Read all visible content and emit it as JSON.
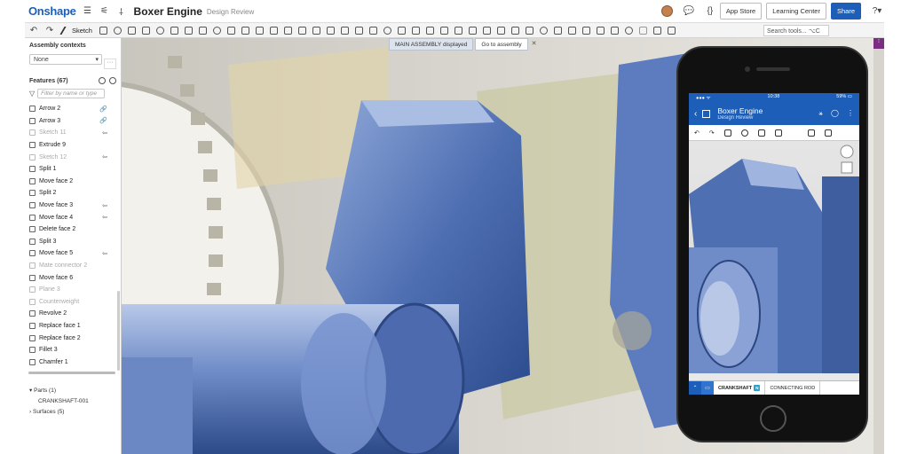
{
  "app": {
    "logo": "Onshape",
    "doc_title": "Boxer Engine",
    "doc_subtitle": "Design Review",
    "buttons": {
      "app_store": "App Store",
      "learning_center": "Learning Center",
      "share": "Share"
    }
  },
  "toolbar": {
    "sketch_label": "Sketch",
    "search_placeholder": "Search tools... ⌥C"
  },
  "banner": {
    "message": "MAIN ASSEMBLY displayed",
    "goto": "Go to assembly",
    "close": "✕"
  },
  "panel": {
    "assembly_contexts_label": "Assembly contexts",
    "context_value": "None",
    "features_label": "Features (67)",
    "filter_placeholder": "Filter by name or type",
    "features": [
      {
        "name": "Arrow 2",
        "dim": false,
        "mark": "🔗"
      },
      {
        "name": "Arrow 3",
        "dim": false,
        "mark": "🔗"
      },
      {
        "name": "Sketch 11",
        "dim": true,
        "mark": "⇦"
      },
      {
        "name": "Extrude 9",
        "dim": false,
        "mark": ""
      },
      {
        "name": "Sketch 12",
        "dim": true,
        "mark": "⇦"
      },
      {
        "name": "Split 1",
        "dim": false,
        "mark": ""
      },
      {
        "name": "Move face 2",
        "dim": false,
        "mark": ""
      },
      {
        "name": "Split 2",
        "dim": false,
        "mark": ""
      },
      {
        "name": "Move face 3",
        "dim": false,
        "mark": "⇦"
      },
      {
        "name": "Move face 4",
        "dim": false,
        "mark": "⇦"
      },
      {
        "name": "Delete face 2",
        "dim": false,
        "mark": ""
      },
      {
        "name": "Split 3",
        "dim": false,
        "mark": ""
      },
      {
        "name": "Move face 5",
        "dim": false,
        "mark": "⇦"
      },
      {
        "name": "Mate connector 2",
        "dim": true,
        "mark": ""
      },
      {
        "name": "Move face 6",
        "dim": false,
        "mark": ""
      },
      {
        "name": "Plane 3",
        "dim": true,
        "mark": ""
      },
      {
        "name": "Counterweight",
        "dim": true,
        "mark": ""
      },
      {
        "name": "Revolve 2",
        "dim": false,
        "mark": ""
      },
      {
        "name": "Replace face 1",
        "dim": false,
        "mark": ""
      },
      {
        "name": "Replace face 2",
        "dim": false,
        "mark": ""
      },
      {
        "name": "Fillet 3",
        "dim": false,
        "mark": ""
      },
      {
        "name": "Chamfer 1",
        "dim": false,
        "mark": ""
      }
    ],
    "parts_label": "Parts (1)",
    "part_name": "CRANKSHAFT-001",
    "surfaces_label": "Surfaces (5)"
  },
  "phone": {
    "time": "10:38",
    "battery": "59% ▭",
    "title": "Boxer Engine",
    "subtitle": "Design Review",
    "tabs": {
      "crankshaft": "CRANKSHAFT",
      "badge": "N",
      "connecting_rod": "CONNECTING ROD"
    }
  },
  "colors": {
    "brand_blue": "#1d5fb8",
    "part_blue": "#5577bb"
  }
}
